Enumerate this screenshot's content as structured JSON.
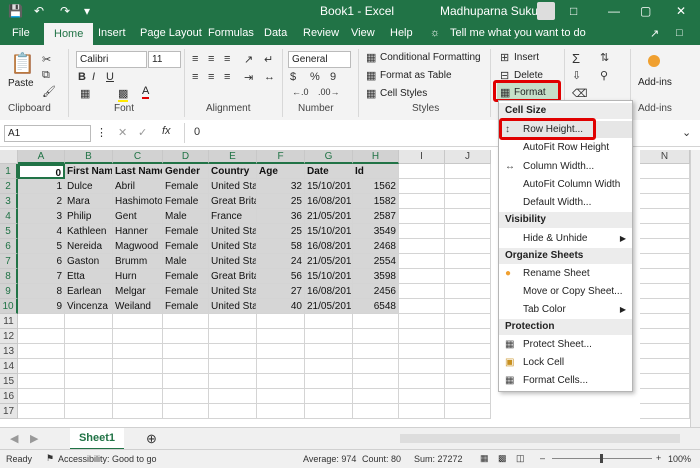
{
  "titlebar": {
    "doc_title": "Book1  -  Excel",
    "user": "Madhuparna Sukul"
  },
  "tabs": [
    "File",
    "Home",
    "Insert",
    "Page Layout",
    "Formulas",
    "Data",
    "Review",
    "View",
    "Help"
  ],
  "tell_me": "Tell me what you want to do",
  "ribbon": {
    "clipboard": {
      "label": "Clipboard",
      "paste": "Paste"
    },
    "font": {
      "label": "Font",
      "name": "Calibri",
      "size": "11",
      "bold": "B",
      "italic": "I",
      "underline": "U"
    },
    "alignment": {
      "label": "Alignment"
    },
    "number": {
      "label": "Number",
      "format": "General",
      "percent": "%",
      "comma": "9"
    },
    "styles": {
      "label": "Styles",
      "conditional": "Conditional Formatting",
      "format_table": "Format as Table",
      "cell_styles": "Cell Styles"
    },
    "cells": {
      "insert": "Insert",
      "delete": "Delete",
      "format": "Format"
    },
    "addins": {
      "label": "Add-ins",
      "name": "Add-ins"
    }
  },
  "formula_bar": {
    "name_box": "A1",
    "fx": "fx",
    "value": "0"
  },
  "columns": [
    "A",
    "B",
    "C",
    "D",
    "E",
    "F",
    "G",
    "H",
    "I",
    "J",
    "N"
  ],
  "rows": [
    "1",
    "2",
    "3",
    "4",
    "5",
    "6",
    "7",
    "8",
    "9",
    "10",
    "11",
    "12",
    "13",
    "14",
    "15",
    "16",
    "17"
  ],
  "table": {
    "headers": [
      "0",
      "First Name",
      "Last Name",
      "Gender",
      "Country",
      "Age",
      "Date",
      "Id"
    ],
    "data": [
      [
        "1",
        "Dulce",
        "Abril",
        "Female",
        "United Sta",
        "32",
        "15/10/201",
        "1562"
      ],
      [
        "2",
        "Mara",
        "Hashimoto",
        "Female",
        "Great Brita",
        "25",
        "16/08/201",
        "1582"
      ],
      [
        "3",
        "Philip",
        "Gent",
        "Male",
        "France",
        "36",
        "21/05/201",
        "2587"
      ],
      [
        "4",
        "Kathleen",
        "Hanner",
        "Female",
        "United Sta",
        "25",
        "15/10/201",
        "3549"
      ],
      [
        "5",
        "Nereida",
        "Magwood",
        "Female",
        "United Sta",
        "58",
        "16/08/201",
        "2468"
      ],
      [
        "6",
        "Gaston",
        "Brumm",
        "Male",
        "United Sta",
        "24",
        "21/05/201",
        "2554"
      ],
      [
        "7",
        "Etta",
        "Hurn",
        "Female",
        "Great Brita",
        "56",
        "15/10/201",
        "3598"
      ],
      [
        "8",
        "Earlean",
        "Melgar",
        "Female",
        "United Sta",
        "27",
        "16/08/201",
        "2456"
      ],
      [
        "9",
        "Vincenza",
        "Weiland",
        "Female",
        "United Sta",
        "40",
        "21/05/201",
        "6548"
      ]
    ]
  },
  "menu": {
    "cell_size": "Cell Size",
    "row_height": "Row Height...",
    "autofit_row": "AutoFit Row Height",
    "col_width": "Column Width...",
    "autofit_col": "AutoFit Column Width",
    "default_width": "Default Width...",
    "visibility": "Visibility",
    "hide_unhide": "Hide & Unhide",
    "organize": "Organize Sheets",
    "rename": "Rename Sheet",
    "move_copy": "Move or Copy Sheet...",
    "tab_color": "Tab Color",
    "protection": "Protection",
    "protect": "Protect Sheet...",
    "lock": "Lock Cell",
    "format_cells": "Format Cells..."
  },
  "sheet_tab": "Sheet1",
  "status": {
    "ready": "Ready",
    "accessibility": "Accessibility: Good to go",
    "average": "Average: 974",
    "count": "Count: 80",
    "sum": "Sum: 27272",
    "zoom": "100%"
  },
  "colors": {
    "excel_green": "#217346",
    "highlight_red": "#e00000"
  }
}
